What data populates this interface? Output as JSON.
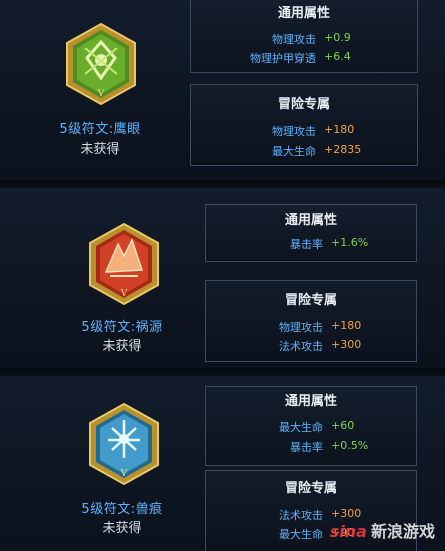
{
  "runes": [
    {
      "name": "5级符文:鹰眼",
      "status": "未获得",
      "general_title": "通用属性",
      "general_stats": [
        {
          "label": "物理攻击",
          "value": "+0.9"
        },
        {
          "label": "物理护甲穿透",
          "value": "+6.4"
        }
      ],
      "adventure_title": "冒险专属",
      "adventure_stats": [
        {
          "label": "物理攻击",
          "value": "+180"
        },
        {
          "label": "最大生命",
          "value": "+2835"
        }
      ],
      "icon": "green-hexagon-rune-icon",
      "color": "#7cc23a"
    },
    {
      "name": "5级符文:祸源",
      "status": "未获得",
      "general_title": "通用属性",
      "general_stats": [
        {
          "label": "暴击率",
          "value": "+1.6%"
        }
      ],
      "adventure_title": "冒险专属",
      "adventure_stats": [
        {
          "label": "物理攻击",
          "value": "+180"
        },
        {
          "label": "法术攻击",
          "value": "+300"
        }
      ],
      "icon": "red-hexagon-rune-icon",
      "color": "#d8452a"
    },
    {
      "name": "5级符文:兽痕",
      "status": "未获得",
      "general_title": "通用属性",
      "general_stats": [
        {
          "label": "最大生命",
          "value": "+60"
        },
        {
          "label": "暴击率",
          "value": "+0.5%"
        }
      ],
      "adventure_title": "冒险专属",
      "adventure_stats": [
        {
          "label": "法术攻击",
          "value": "+300"
        },
        {
          "label": "最大生命",
          "value": "+90"
        }
      ],
      "icon": "blue-hexagon-rune-icon",
      "color": "#4aa3d6"
    }
  ],
  "watermark": {
    "logo": "sina",
    "text": "新浪游戏"
  }
}
